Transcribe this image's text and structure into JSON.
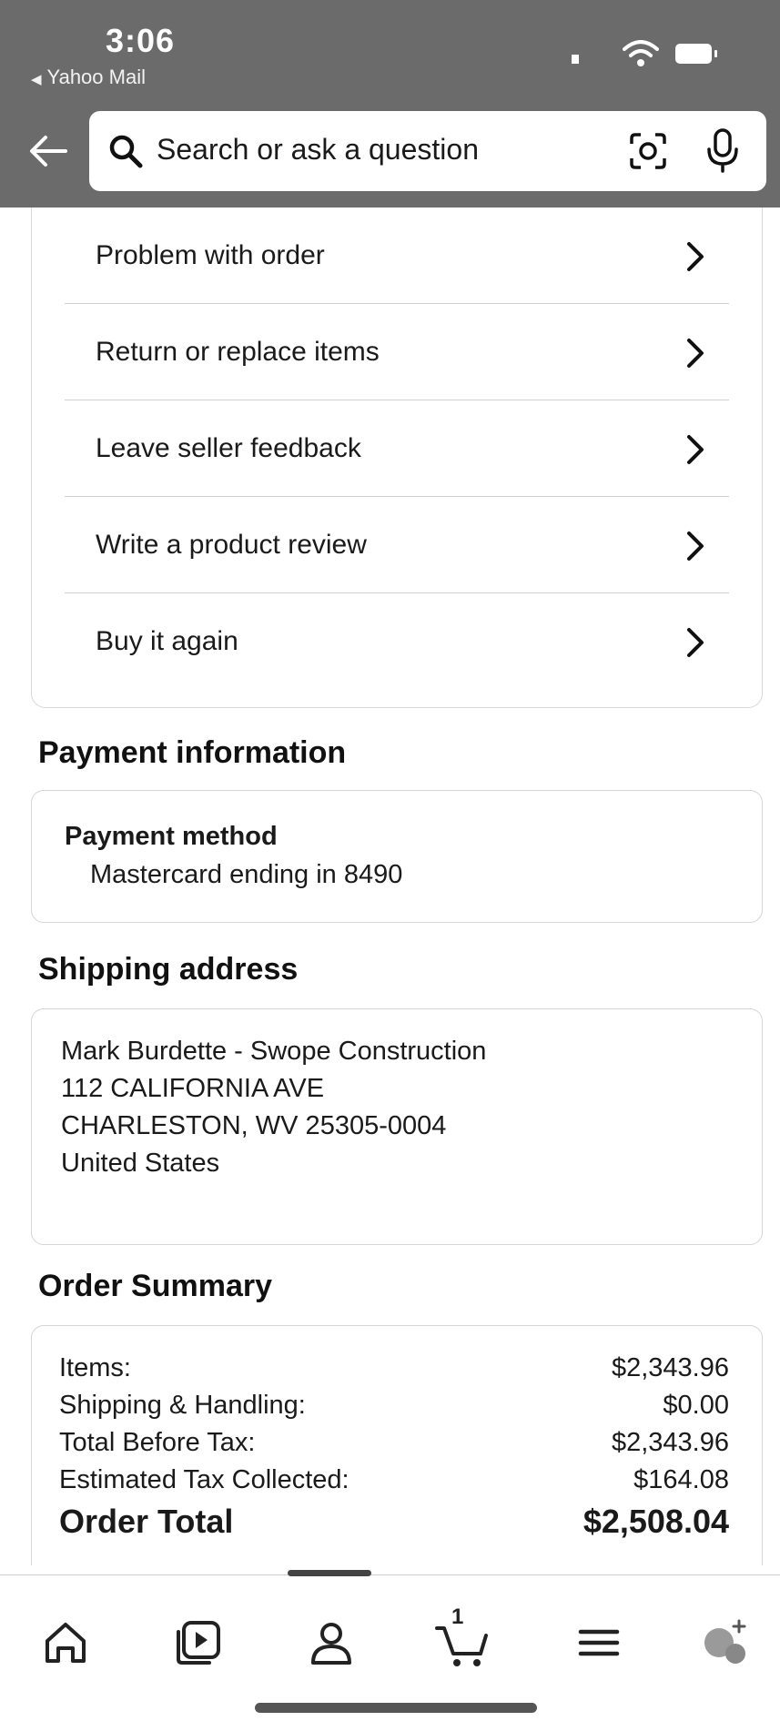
{
  "status_bar": {
    "time": "3:06",
    "back_app": "Yahoo Mail"
  },
  "search": {
    "placeholder": "Search or ask a question"
  },
  "order_actions": [
    {
      "label": "Problem with order"
    },
    {
      "label": "Return or replace items"
    },
    {
      "label": "Leave seller feedback"
    },
    {
      "label": "Write a product review"
    },
    {
      "label": "Buy it again"
    }
  ],
  "payment": {
    "section_title": "Payment information",
    "method_heading": "Payment method",
    "method_value": "Mastercard ending in 8490"
  },
  "shipping": {
    "section_title": "Shipping address",
    "lines": [
      "Mark Burdette - Swope Construction",
      "112 CALIFORNIA AVE",
      "CHARLESTON, WV 25305-0004",
      "United States"
    ]
  },
  "summary": {
    "section_title": "Order Summary",
    "rows": [
      {
        "label": "Items:",
        "value": "$2,343.96"
      },
      {
        "label": "Shipping & Handling:",
        "value": "$0.00"
      },
      {
        "label": "Total Before Tax:",
        "value": "$2,343.96"
      },
      {
        "label": "Estimated Tax Collected:",
        "value": "$164.08"
      }
    ],
    "total_label": "Order Total",
    "total_value": "$2,508.04"
  },
  "bottom_nav": {
    "items": [
      {
        "icon": "home-icon"
      },
      {
        "icon": "video-icon"
      },
      {
        "icon": "account-icon"
      },
      {
        "icon": "cart-icon",
        "badge": "1"
      },
      {
        "icon": "menu-icon"
      },
      {
        "icon": "rufus-icon"
      }
    ],
    "active_index": 2
  },
  "colors": {
    "header_bg": "#6b6b6b",
    "divider": "#d0d0d0",
    "text": "#1a1a1a"
  }
}
